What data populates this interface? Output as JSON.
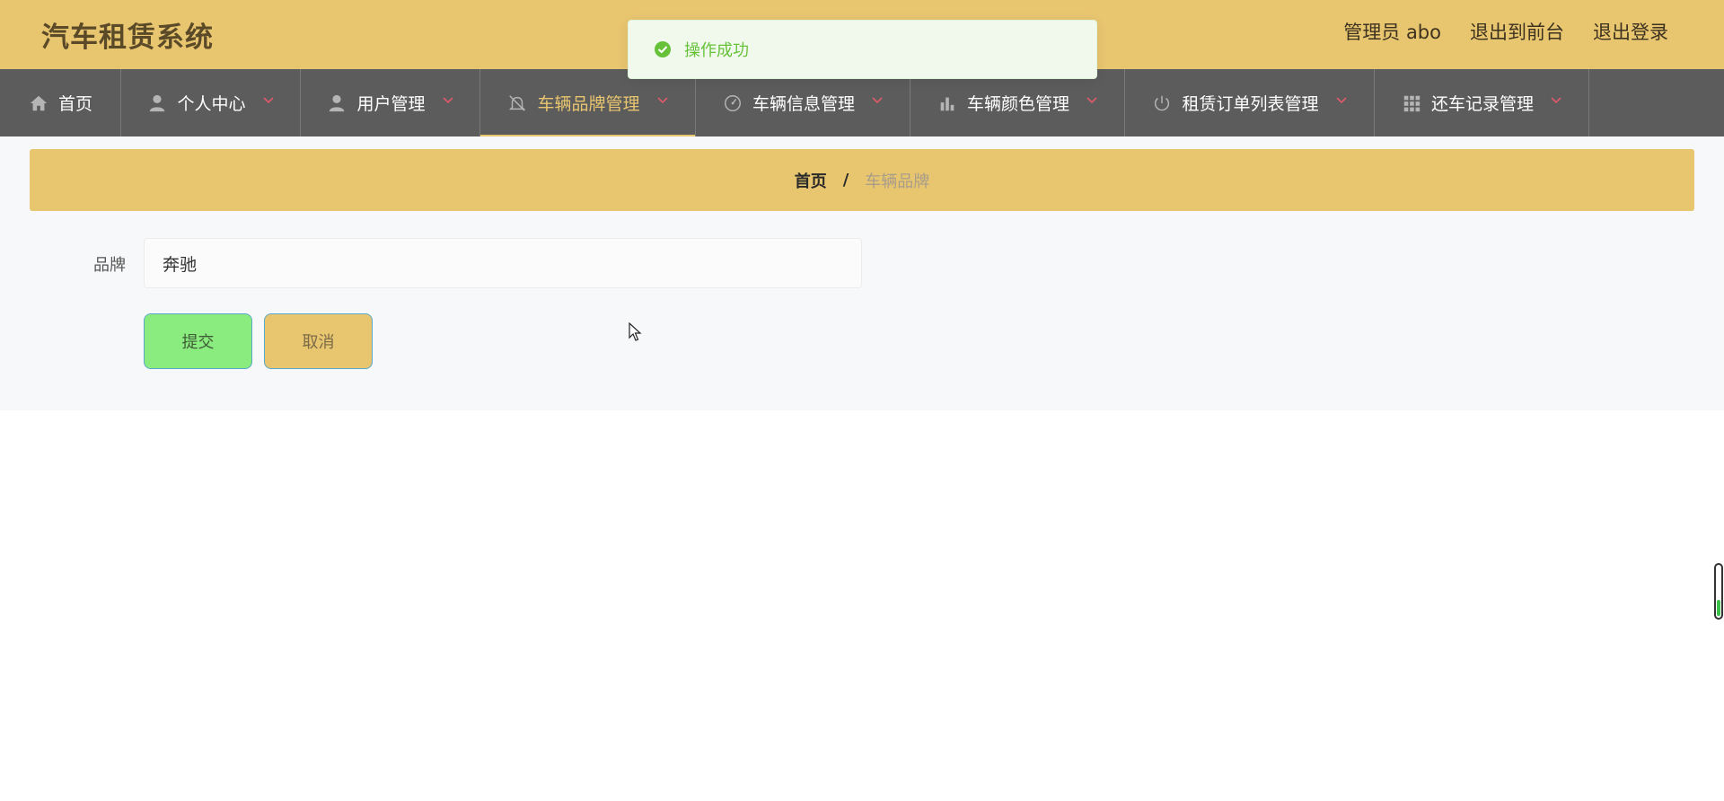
{
  "header": {
    "title": "汽车租赁系统",
    "user": "管理员 abo",
    "to_frontend": "退出到前台",
    "logout": "退出登录"
  },
  "nav": {
    "items": [
      {
        "label": "首页",
        "icon": "home-icon",
        "has_dropdown": false,
        "active": false
      },
      {
        "label": "个人中心",
        "icon": "user-icon",
        "has_dropdown": true,
        "active": false
      },
      {
        "label": "用户管理",
        "icon": "user-icon",
        "has_dropdown": true,
        "active": false
      },
      {
        "label": "车辆品牌管理",
        "icon": "bell-off-icon",
        "has_dropdown": true,
        "active": true
      },
      {
        "label": "车辆信息管理",
        "icon": "dashboard-icon",
        "has_dropdown": true,
        "active": false
      },
      {
        "label": "车辆颜色管理",
        "icon": "bar-chart-icon",
        "has_dropdown": true,
        "active": false
      },
      {
        "label": "租赁订单列表管理",
        "icon": "power-icon",
        "has_dropdown": true,
        "active": false
      },
      {
        "label": "还车记录管理",
        "icon": "grid-icon",
        "has_dropdown": true,
        "active": false
      }
    ]
  },
  "breadcrumb": {
    "home": "首页",
    "separator": "/",
    "current": "车辆品牌"
  },
  "form": {
    "brand_label": "品牌",
    "brand_value": "奔驰",
    "submit_label": "提交",
    "cancel_label": "取消"
  },
  "toast": {
    "message": "操作成功",
    "type": "success"
  },
  "colors": {
    "accent": "#e8c56f",
    "nav_bg": "#5c5c5c",
    "submit_bg": "#8aec7f",
    "toast_text": "#67c23a"
  }
}
